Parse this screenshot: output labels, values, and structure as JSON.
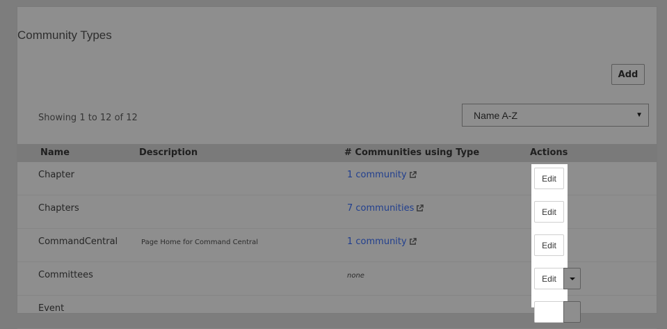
{
  "page": {
    "title": "Community Types",
    "add_label": "Add",
    "showing": "Showing 1 to 12 of 12",
    "sort": {
      "selected": "Name A-Z"
    }
  },
  "table": {
    "headers": {
      "name": "Name",
      "description": "Description",
      "communities": "# Communities using Type",
      "actions": "Actions"
    },
    "rows": [
      {
        "name": "Chapter",
        "description": "",
        "communities": "1 community",
        "action": "Edit"
      },
      {
        "name": "Chapters",
        "description": "",
        "communities": "7 communities",
        "action": "Edit"
      },
      {
        "name": "CommandCentral",
        "description": "Page Home for Command Central",
        "communities": "1 community",
        "action": "Edit"
      },
      {
        "name": "Committees",
        "description": "",
        "communities": "none",
        "action": "Edit"
      },
      {
        "name": "Event",
        "description": "",
        "communities": "",
        "action": ""
      }
    ]
  },
  "colors": {
    "link": "#213f8e",
    "highlight": "#ffffff"
  }
}
